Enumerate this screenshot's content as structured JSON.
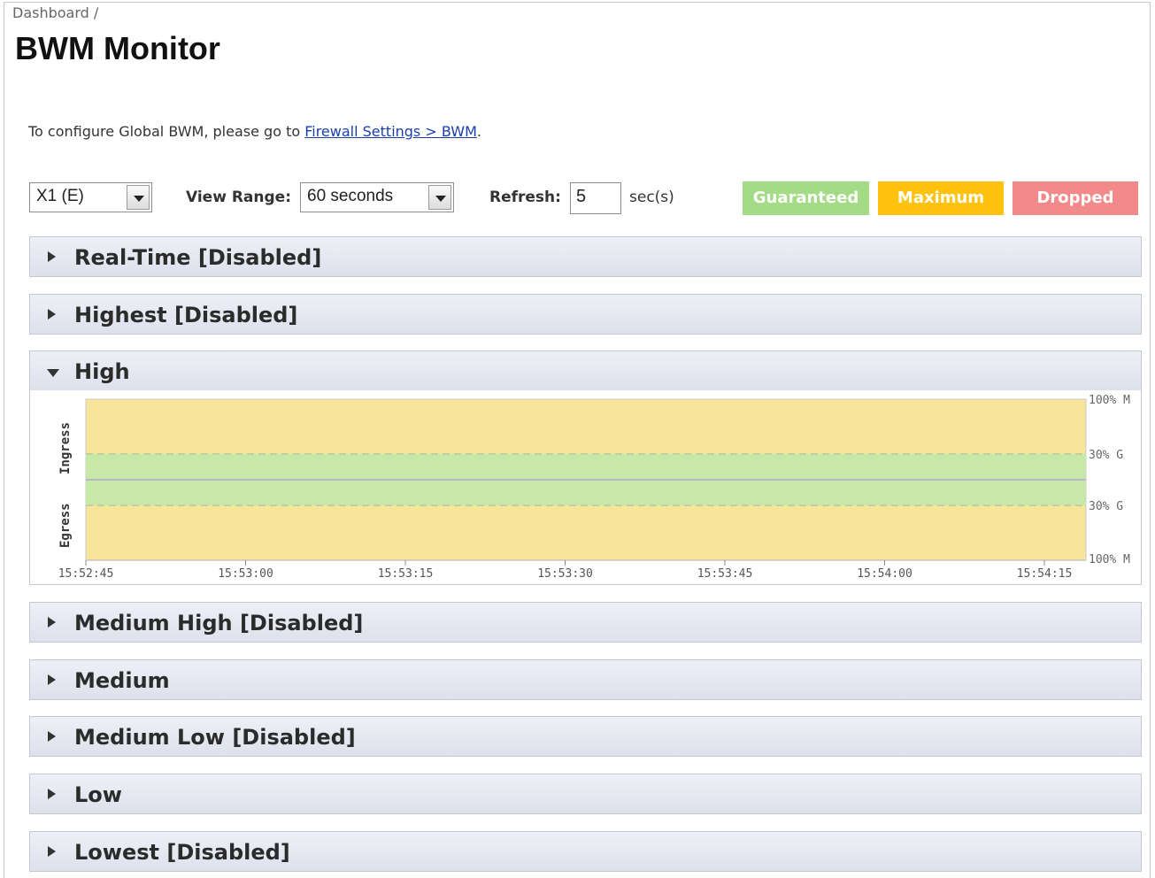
{
  "breadcrumb": "Dashboard /",
  "title": "BWM Monitor",
  "config": {
    "text": "To configure Global BWM, please go to ",
    "link": "Firewall Settings > BWM",
    "suffix": "."
  },
  "controls": {
    "interface": "X1 (E)",
    "view_range_label": "View Range:",
    "view_range": "60 seconds",
    "refresh_label": "Refresh:",
    "refresh_value": "5",
    "refresh_unit": "sec(s)"
  },
  "legend": [
    {
      "label": "Guaranteed",
      "color": "#9fdb7d"
    },
    {
      "label": "Maximum",
      "color": "#ffc107"
    },
    {
      "label": "Dropped",
      "color": "#f08585"
    }
  ],
  "panels": [
    {
      "label": "Real-Time [Disabled]",
      "expanded": false
    },
    {
      "label": "Highest [Disabled]",
      "expanded": false
    },
    {
      "label": "High",
      "expanded": true
    },
    {
      "label": "Medium High [Disabled]",
      "expanded": false
    },
    {
      "label": "Medium",
      "expanded": false
    },
    {
      "label": "Medium Low [Disabled]",
      "expanded": false
    },
    {
      "label": "Low",
      "expanded": false
    },
    {
      "label": "Lowest [Disabled]",
      "expanded": false
    }
  ],
  "chart_data": {
    "type": "area",
    "ingress_label": "Ingress",
    "egress_label": "Egress",
    "x_ticks": [
      "15:52:45",
      "15:53:00",
      "15:53:15",
      "15:53:30",
      "15:53:45",
      "15:54:00",
      "15:54:15"
    ],
    "right_labels": [
      "100% M",
      "30% G",
      "30% G",
      "100% M"
    ],
    "ingress": {
      "maximum_pct": 100,
      "guaranteed_pct": 30
    },
    "egress": {
      "maximum_pct": 100,
      "guaranteed_pct": 30
    },
    "colors": {
      "maximum": "#f7e59a",
      "guaranteed": "#c8e8a8"
    }
  }
}
